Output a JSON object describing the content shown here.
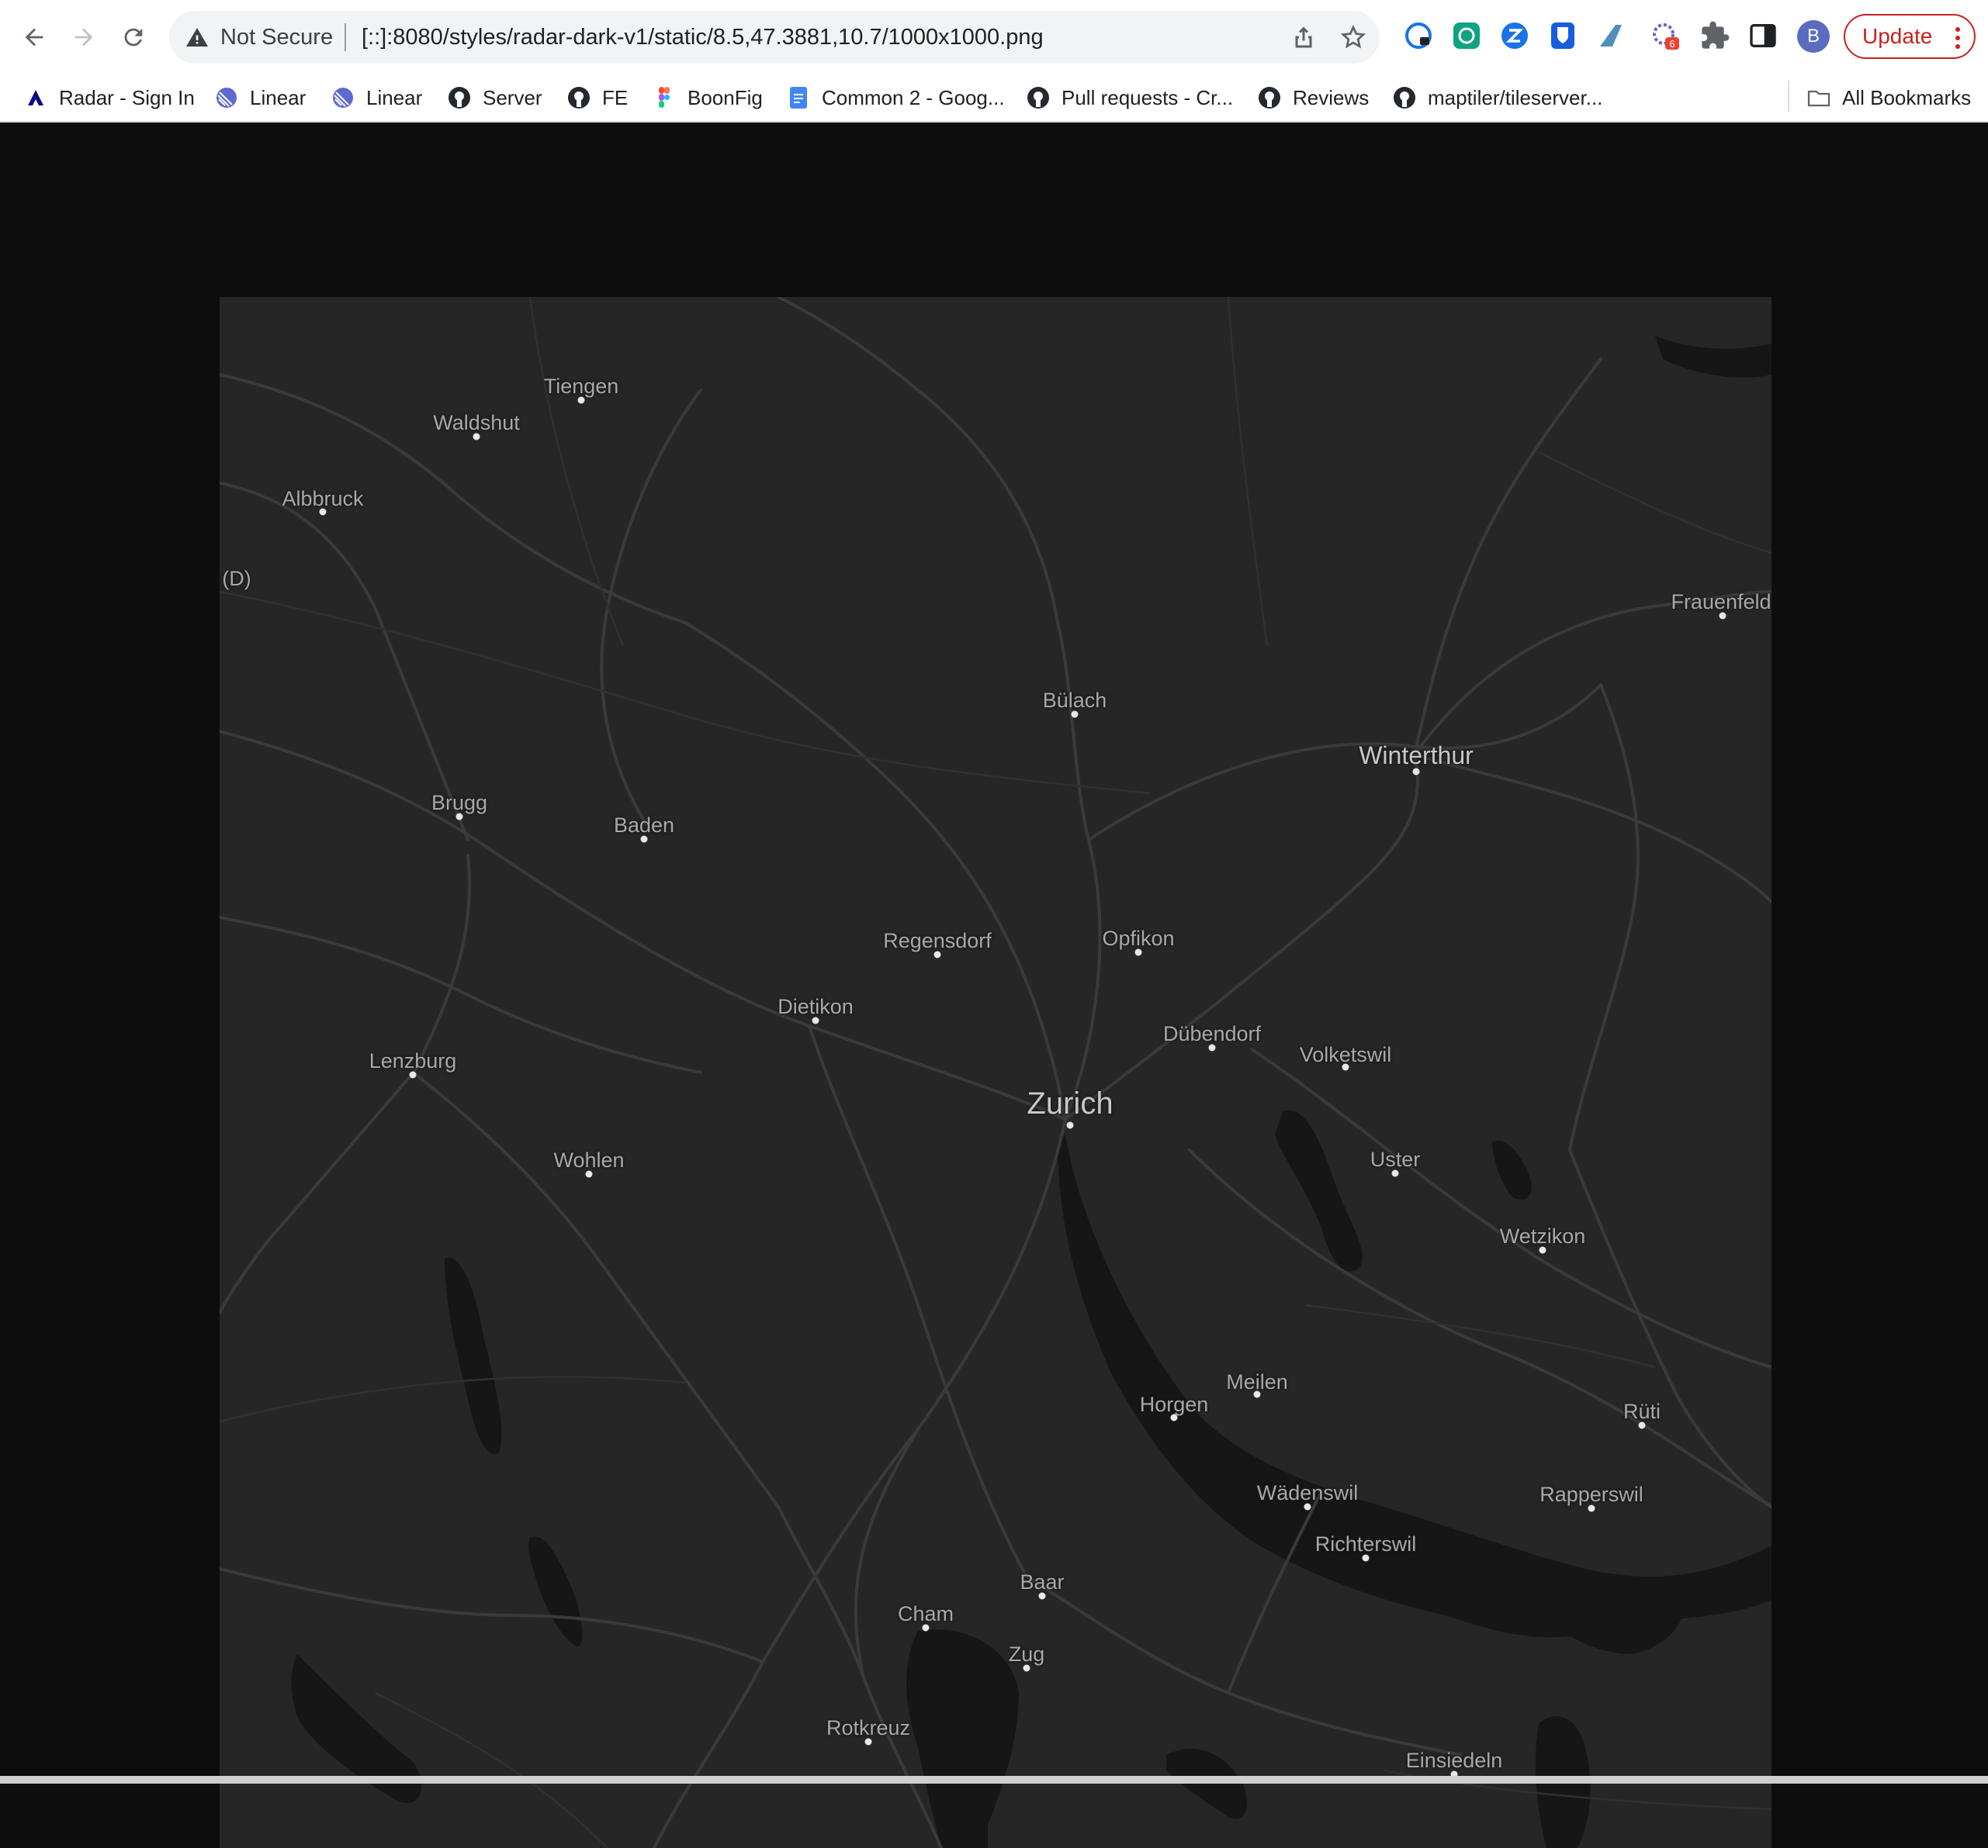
{
  "browser": {
    "security_label": "Not Secure",
    "url": "[::]:8080/styles/radar-dark-v1/static/8.5,47.3881,10.7/1000x1000.png",
    "profile_initial": "B",
    "update_label": "Update",
    "extension_badge": "6"
  },
  "bookmarks": [
    {
      "label": "Radar - Sign In",
      "icon": "radar-icon"
    },
    {
      "label": "Linear",
      "icon": "linear-icon"
    },
    {
      "label": "Linear",
      "icon": "linear-icon"
    },
    {
      "label": "Server",
      "icon": "github-icon"
    },
    {
      "label": "FE",
      "icon": "github-icon"
    },
    {
      "label": "BoonFig",
      "icon": "figma-icon"
    },
    {
      "label": "Common 2 - Goog...",
      "icon": "google-docs-icon"
    },
    {
      "label": "Pull requests - Cr...",
      "icon": "github-icon"
    },
    {
      "label": "Reviews",
      "icon": "github-icon"
    },
    {
      "label": "maptiler/tileserver...",
      "icon": "github-icon"
    }
  ],
  "all_bookmarks_label": "All Bookmarks",
  "map": {
    "colors": {
      "land": "#262626",
      "water": "#161616",
      "roads": "#3a3a3a",
      "labels": "#a8a8a8"
    },
    "places": [
      {
        "name": "Tiengen"
      },
      {
        "name": "Waldshut"
      },
      {
        "name": "Albbruck"
      },
      {
        "name": "(D)"
      },
      {
        "name": "Frauenfeld"
      },
      {
        "name": "Bülach"
      },
      {
        "name": "Winterthur"
      },
      {
        "name": "Brugg"
      },
      {
        "name": "Baden"
      },
      {
        "name": "Regensdorf"
      },
      {
        "name": "Opfikon"
      },
      {
        "name": "Dietikon"
      },
      {
        "name": "Dübendorf"
      },
      {
        "name": "Volketswil"
      },
      {
        "name": "Lenzburg"
      },
      {
        "name": "Zurich"
      },
      {
        "name": "Uster"
      },
      {
        "name": "Wohlen"
      },
      {
        "name": "Wetzikon"
      },
      {
        "name": "Meilen"
      },
      {
        "name": "Horgen"
      },
      {
        "name": "Rüti"
      },
      {
        "name": "Wädenswil"
      },
      {
        "name": "Rapperswil"
      },
      {
        "name": "Richterswil"
      },
      {
        "name": "Baar"
      },
      {
        "name": "Cham"
      },
      {
        "name": "Zug"
      },
      {
        "name": "Rotkreuz"
      },
      {
        "name": "Einsiedeln"
      }
    ]
  }
}
